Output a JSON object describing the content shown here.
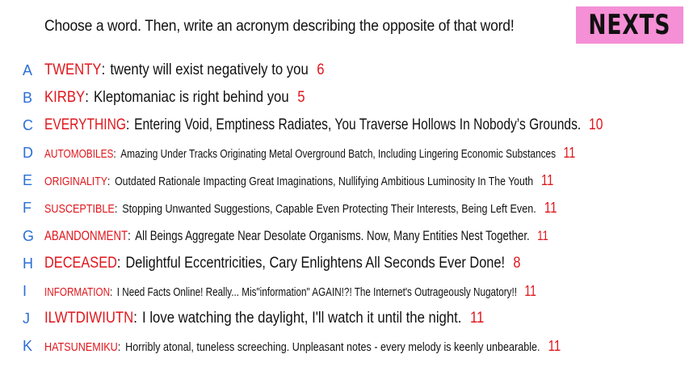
{
  "prompt": "Choose a word. Then, write an acronym describing the opposite of that word!",
  "logo": "NEXTS",
  "colors": {
    "letter": "#2b6fd6",
    "word": "#e0161c",
    "logo_bg": "#f58fd6"
  },
  "rows": [
    {
      "letter": "A",
      "word": "TWENTY",
      "text": "twenty will exist negatively to you",
      "count": "6"
    },
    {
      "letter": "B",
      "word": "KIRBY",
      "text": "Kleptomaniac is right behind you",
      "count": "5"
    },
    {
      "letter": "C",
      "word": "EVERYTHING",
      "text": "Entering Void, Emptiness Radiates, You Traverse Hollows In Nobody’s Grounds.",
      "count": "10"
    },
    {
      "letter": "D",
      "word": "AUTOMOBILES",
      "text": "Amazing Under Tracks Originating Metal Overground Batch, Including Lingering Economic Substances",
      "count": "11"
    },
    {
      "letter": "E",
      "word": "ORIGINALITY",
      "text": "Outdated Rationale Impacting Great Imaginations, Nullifying Ambitious Luminosity In The Youth",
      "count": "11"
    },
    {
      "letter": "F",
      "word": "SUSCEPTIBLE",
      "text": "Stopping Unwanted Suggestions, Capable Even Protecting Their Interests, Being Left Even.",
      "count": "11"
    },
    {
      "letter": "G",
      "word": "ABANDONMENT",
      "text": "All Beings Aggregate Near Desolate Organisms. Now, Many Entities Nest Together.",
      "count": "11"
    },
    {
      "letter": "H",
      "word": "DECEASED",
      "text": "Delightful Eccentricities, Cary Enlightens All Seconds Ever Done!",
      "count": "8"
    },
    {
      "letter": "I",
      "word": "INFORMATION",
      "text": "I Need Facts Online! Really... Mis\"information\" AGAIN!?! The Internet's Outrageously Nugatory!!",
      "count": "11"
    },
    {
      "letter": "J",
      "word": "ILWTDIWIUTN",
      "text": "I love watching the daylight, I'll watch it until the night.",
      "count": "11"
    },
    {
      "letter": "K",
      "word": "HATSUNEMIKU",
      "text": "Horribly atonal, tuneless screeching. Unpleasant notes - every melody is keenly unbearable.",
      "count": "11"
    }
  ]
}
